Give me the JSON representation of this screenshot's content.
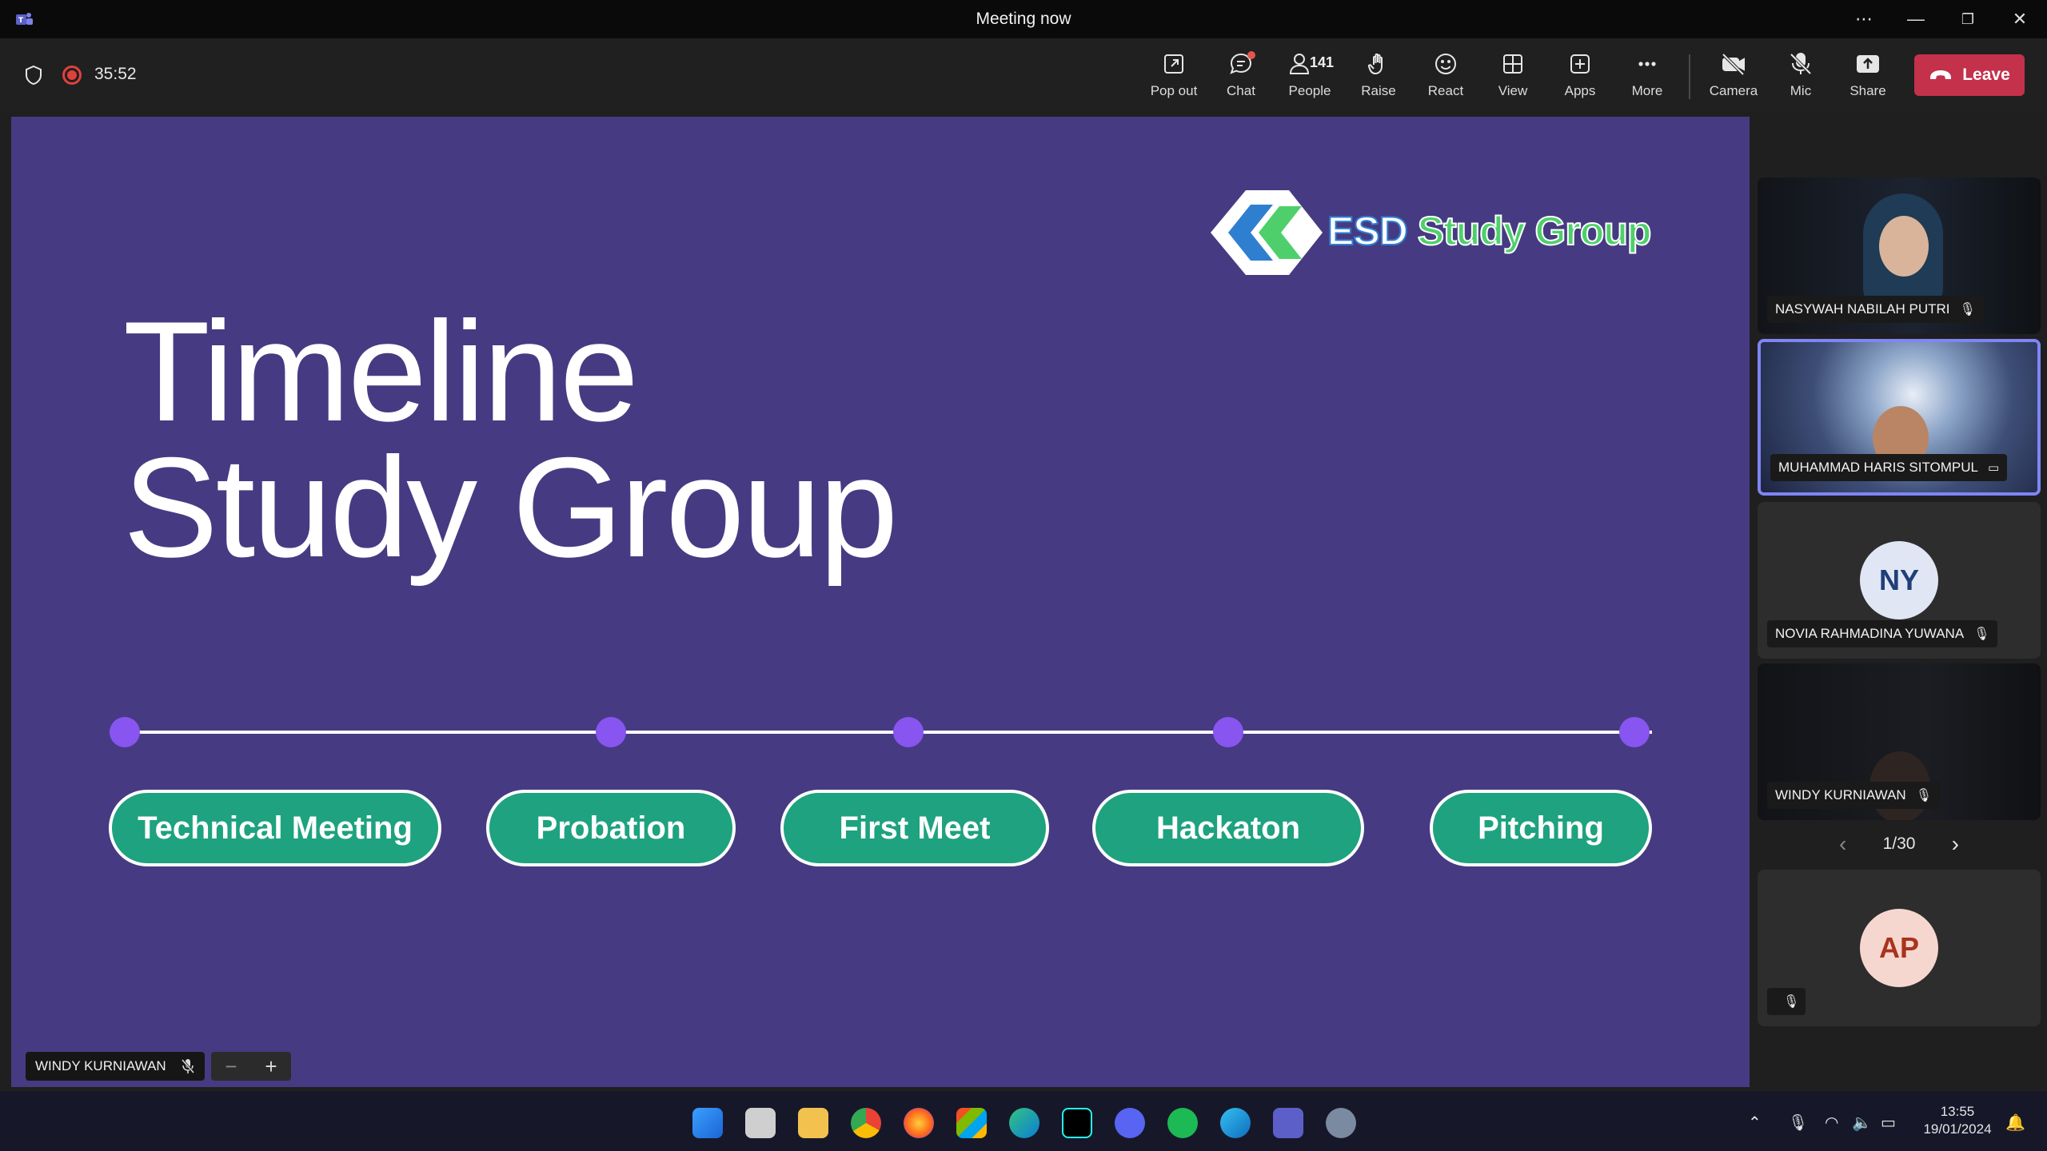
{
  "window": {
    "title": "Meeting now",
    "more_label": "⋯",
    "minimize_label": "—",
    "restore_label": "❐",
    "close_label": "✕"
  },
  "toolbar": {
    "timer": "35:52",
    "pop_out": "Pop out",
    "chat": "Chat",
    "people": "People",
    "people_count": "141",
    "raise": "Raise",
    "react": "React",
    "view": "View",
    "apps": "Apps",
    "more": "More",
    "camera": "Camera",
    "mic": "Mic",
    "share": "Share",
    "leave": "Leave"
  },
  "slide": {
    "title_line1": "Timeline",
    "title_line2": "Study Group",
    "logo_esd": "ESD",
    "logo_study_group": "Study Group",
    "timeline": [
      "Technical Meeting",
      "Probation",
      "First Meet",
      "Hackaton",
      "Pitching"
    ]
  },
  "presenter": {
    "name": "WINDY KURNIAWAN",
    "zoom_out": "−",
    "zoom_in": "+"
  },
  "participants": [
    {
      "name": "NASYWAH NABILAH PUTRI",
      "initials": ""
    },
    {
      "name": "MUHAMMAD HARIS SITOMPUL",
      "initials": ""
    },
    {
      "name": "NOVIA RAHMADINA YUWANA",
      "initials": "NY"
    },
    {
      "name": "WINDY KURNIAWAN",
      "initials": ""
    },
    {
      "name": "",
      "initials": "AP"
    }
  ],
  "pager": {
    "prev": "‹",
    "label": "1/30",
    "next": "›"
  },
  "taskbar": {
    "time": "13:55",
    "date": "19/01/2024"
  },
  "colors": {
    "slide_bg": "#463b82",
    "pill": "#1ea27f",
    "dot": "#8855f0",
    "leave": "#c4314b",
    "accent": "#7f85f5"
  }
}
